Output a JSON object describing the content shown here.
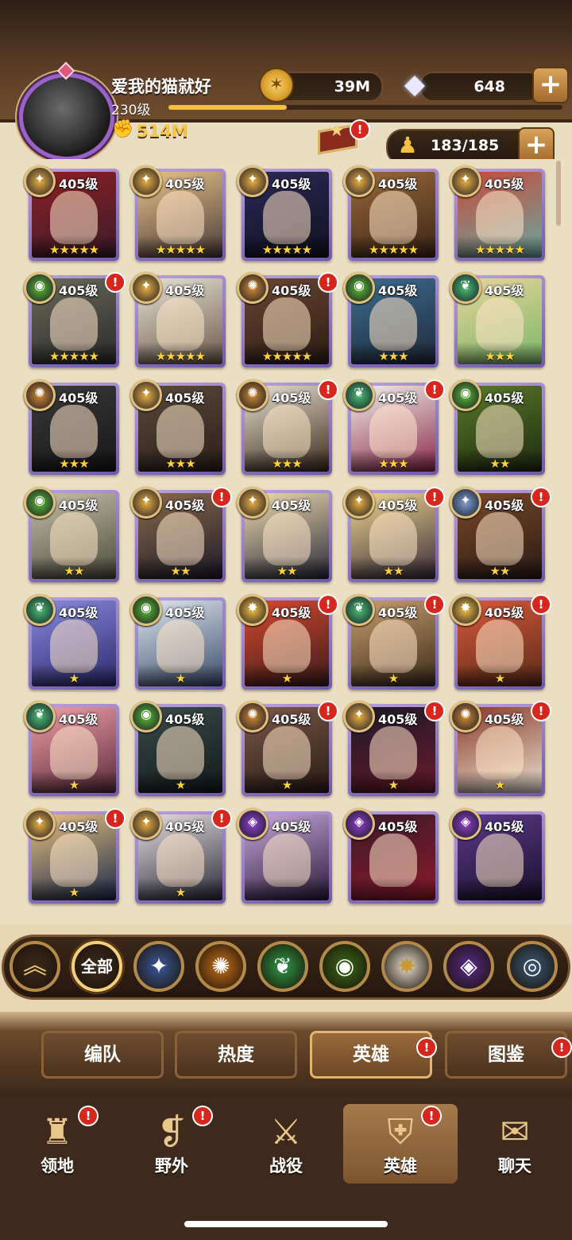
{
  "player": {
    "name": "爱我的猫就好",
    "level": "230级",
    "power": "514M",
    "xp_progress": 0.3
  },
  "resources": {
    "gold": "39M",
    "gems": "648",
    "roster": "183/185"
  },
  "colors": {
    "light_blue": "#7ea0cf",
    "celestial": "#f4c040",
    "lightbearer": "#e9b040",
    "wilder": "#48c070",
    "graveborn": "#5dbb32",
    "mauler": "#d08a30",
    "hypogean": "#9040c8",
    "dimensional": "#6fb0d8"
  },
  "heroes": [
    {
      "level": "405级",
      "faction": "lightbearer",
      "stars": 5,
      "alert": false,
      "art": [
        "#8e1f24",
        "#3a1c2a"
      ]
    },
    {
      "level": "405级",
      "faction": "lightbearer",
      "stars": 5,
      "alert": false,
      "art": [
        "#e7c58a",
        "#4b3a3a"
      ]
    },
    {
      "level": "405级",
      "faction": "lightbearer",
      "stars": 5,
      "alert": false,
      "art": [
        "#2c2a55",
        "#101020"
      ]
    },
    {
      "level": "405级",
      "faction": "lightbearer",
      "stars": 5,
      "alert": false,
      "art": [
        "#9a6a3a",
        "#3a2418"
      ]
    },
    {
      "level": "405级",
      "faction": "lightbearer",
      "stars": 5,
      "alert": false,
      "art": [
        "#c84a3a",
        "#6aa7a0"
      ]
    },
    {
      "level": "405级",
      "faction": "graveborn",
      "stars": 5,
      "alert": true,
      "art": [
        "#6a6a5a",
        "#2a2a2a"
      ]
    },
    {
      "level": "405级",
      "faction": "lightbearer",
      "stars": 5,
      "alert": false,
      "art": [
        "#e8e2d5",
        "#6a5a4a"
      ]
    },
    {
      "level": "405级",
      "faction": "mauler",
      "stars": 5,
      "alert": true,
      "art": [
        "#6a4634",
        "#2c1c14"
      ]
    },
    {
      "level": "405级",
      "faction": "graveborn",
      "stars": 3,
      "alert": false,
      "art": [
        "#3e6c8e",
        "#1e2a3a"
      ]
    },
    {
      "level": "405级",
      "faction": "wilder",
      "stars": 3,
      "alert": false,
      "art": [
        "#e8d39a",
        "#7ab86a"
      ]
    },
    {
      "level": "405级",
      "faction": "mauler",
      "stars": 3,
      "alert": false,
      "art": [
        "#3a3a3a",
        "#161616"
      ]
    },
    {
      "level": "405级",
      "faction": "lightbearer",
      "stars": 3,
      "alert": false,
      "art": [
        "#5a4a3a",
        "#2a1f1a"
      ]
    },
    {
      "level": "405级",
      "faction": "mauler",
      "stars": 3,
      "alert": true,
      "art": [
        "#e8e0d0",
        "#3a2a1c"
      ]
    },
    {
      "level": "405级",
      "faction": "wilder",
      "stars": 3,
      "alert": true,
      "art": [
        "#f2f0ec",
        "#8a2a4a"
      ]
    },
    {
      "level": "405级",
      "faction": "graveborn",
      "stars": 2,
      "alert": false,
      "art": [
        "#5a7a2a",
        "#1e2a10"
      ]
    },
    {
      "level": "405级",
      "faction": "graveborn",
      "stars": 2,
      "alert": false,
      "art": [
        "#c8c0a8",
        "#4a4a3a"
      ]
    },
    {
      "level": "405级",
      "faction": "lightbearer",
      "stars": 2,
      "alert": true,
      "art": [
        "#8a6a4a",
        "#1e1a2a"
      ]
    },
    {
      "level": "405级",
      "faction": "lightbearer",
      "stars": 2,
      "alert": false,
      "art": [
        "#f0dcb0",
        "#2a2a3a"
      ]
    },
    {
      "level": "405级",
      "faction": "lightbearer",
      "stars": 2,
      "alert": true,
      "art": [
        "#f0d890",
        "#3a2a3a"
      ]
    },
    {
      "level": "405级",
      "faction": "light_blue",
      "stars": 2,
      "alert": true,
      "art": [
        "#7a4a2a",
        "#2a1a14"
      ]
    },
    {
      "level": "405级",
      "faction": "wilder",
      "stars": 1,
      "alert": false,
      "art": [
        "#8a8ae0",
        "#2a2a6a"
      ]
    },
    {
      "level": "405级",
      "faction": "graveborn",
      "stars": 1,
      "alert": false,
      "art": [
        "#e0e8f0",
        "#3a4a6a"
      ]
    },
    {
      "level": "405级",
      "faction": "celestial",
      "stars": 1,
      "alert": true,
      "art": [
        "#d84a30",
        "#3a1a1a"
      ]
    },
    {
      "level": "405级",
      "faction": "wilder",
      "stars": 1,
      "alert": true,
      "art": [
        "#caa070",
        "#3a2a1a"
      ]
    },
    {
      "level": "405级",
      "faction": "celestial",
      "stars": 1,
      "alert": true,
      "art": [
        "#d85a3a",
        "#5a2a1a"
      ]
    },
    {
      "level": "405级",
      "faction": "wilder",
      "stars": 1,
      "alert": false,
      "art": [
        "#f0a0a8",
        "#5a2a3a"
      ]
    },
    {
      "level": "405级",
      "faction": "graveborn",
      "stars": 1,
      "alert": false,
      "art": [
        "#3a4a4a",
        "#141a1a"
      ]
    },
    {
      "level": "405级",
      "faction": "mauler",
      "stars": 1,
      "alert": true,
      "art": [
        "#7a5a4a",
        "#2a1a14"
      ]
    },
    {
      "level": "405级",
      "faction": "lightbearer",
      "stars": 1,
      "alert": true,
      "art": [
        "#1a1a2a",
        "#6a1a2a"
      ]
    },
    {
      "level": "405级",
      "faction": "mauler",
      "stars": 1,
      "alert": true,
      "art": [
        "#8a3a2a",
        "#e8e0d0"
      ]
    },
    {
      "level": "405级",
      "faction": "lightbearer",
      "stars": 1,
      "alert": true,
      "art": [
        "#e8c080",
        "#1a2a4a"
      ]
    },
    {
      "level": "405级",
      "faction": "lightbearer",
      "stars": 1,
      "alert": true,
      "art": [
        "#e8e0e0",
        "#2a2a3a"
      ]
    },
    {
      "level": "405级",
      "faction": "hypogean",
      "stars": 0,
      "alert": false,
      "art": [
        "#c8a8d8",
        "#2a1a3a"
      ]
    },
    {
      "level": "405级",
      "faction": "hypogean",
      "stars": 0,
      "alert": false,
      "art": [
        "#3a1a2a",
        "#8a1a2a"
      ]
    },
    {
      "level": "405级",
      "faction": "hypogean",
      "stars": 0,
      "alert": false,
      "art": [
        "#5a3a8a",
        "#1a102a"
      ]
    }
  ],
  "filters": {
    "all_label": "全部",
    "items": [
      {
        "name": "lightbearer",
        "glyph": "✦",
        "color": "#3a5a9a"
      },
      {
        "name": "mauler",
        "glyph": "✺",
        "color": "#c8701a"
      },
      {
        "name": "wilder",
        "glyph": "❦",
        "color": "#2f9a4a"
      },
      {
        "name": "graveborn",
        "glyph": "◉",
        "color": "#3a6a1a"
      },
      {
        "name": "celestial",
        "glyph": "✸",
        "color": "#e8e0d0"
      },
      {
        "name": "hypogean",
        "glyph": "◈",
        "color": "#5a2a8a"
      },
      {
        "name": "dimensional",
        "glyph": "◎",
        "color": "#3a5a7a"
      }
    ]
  },
  "tabs": [
    {
      "label": "编队",
      "active": false,
      "alert": false
    },
    {
      "label": "热度",
      "active": false,
      "alert": false
    },
    {
      "label": "英雄",
      "active": true,
      "alert": true
    },
    {
      "label": "图鉴",
      "active": false,
      "alert": true
    }
  ],
  "nav": [
    {
      "label": "领地",
      "icon": "castle-icon",
      "glyph": "♜",
      "alert": true,
      "active": false
    },
    {
      "label": "野外",
      "icon": "map-scroll-icon",
      "glyph": "❡",
      "alert": true,
      "active": false
    },
    {
      "label": "战役",
      "icon": "sword-emblem-icon",
      "glyph": "⚔",
      "alert": false,
      "active": false
    },
    {
      "label": "英雄",
      "icon": "helmet-icon",
      "glyph": "⛨",
      "alert": true,
      "active": true
    },
    {
      "label": "聊天",
      "icon": "chat-bubble-icon",
      "glyph": "✉",
      "alert": false,
      "active": false
    }
  ]
}
